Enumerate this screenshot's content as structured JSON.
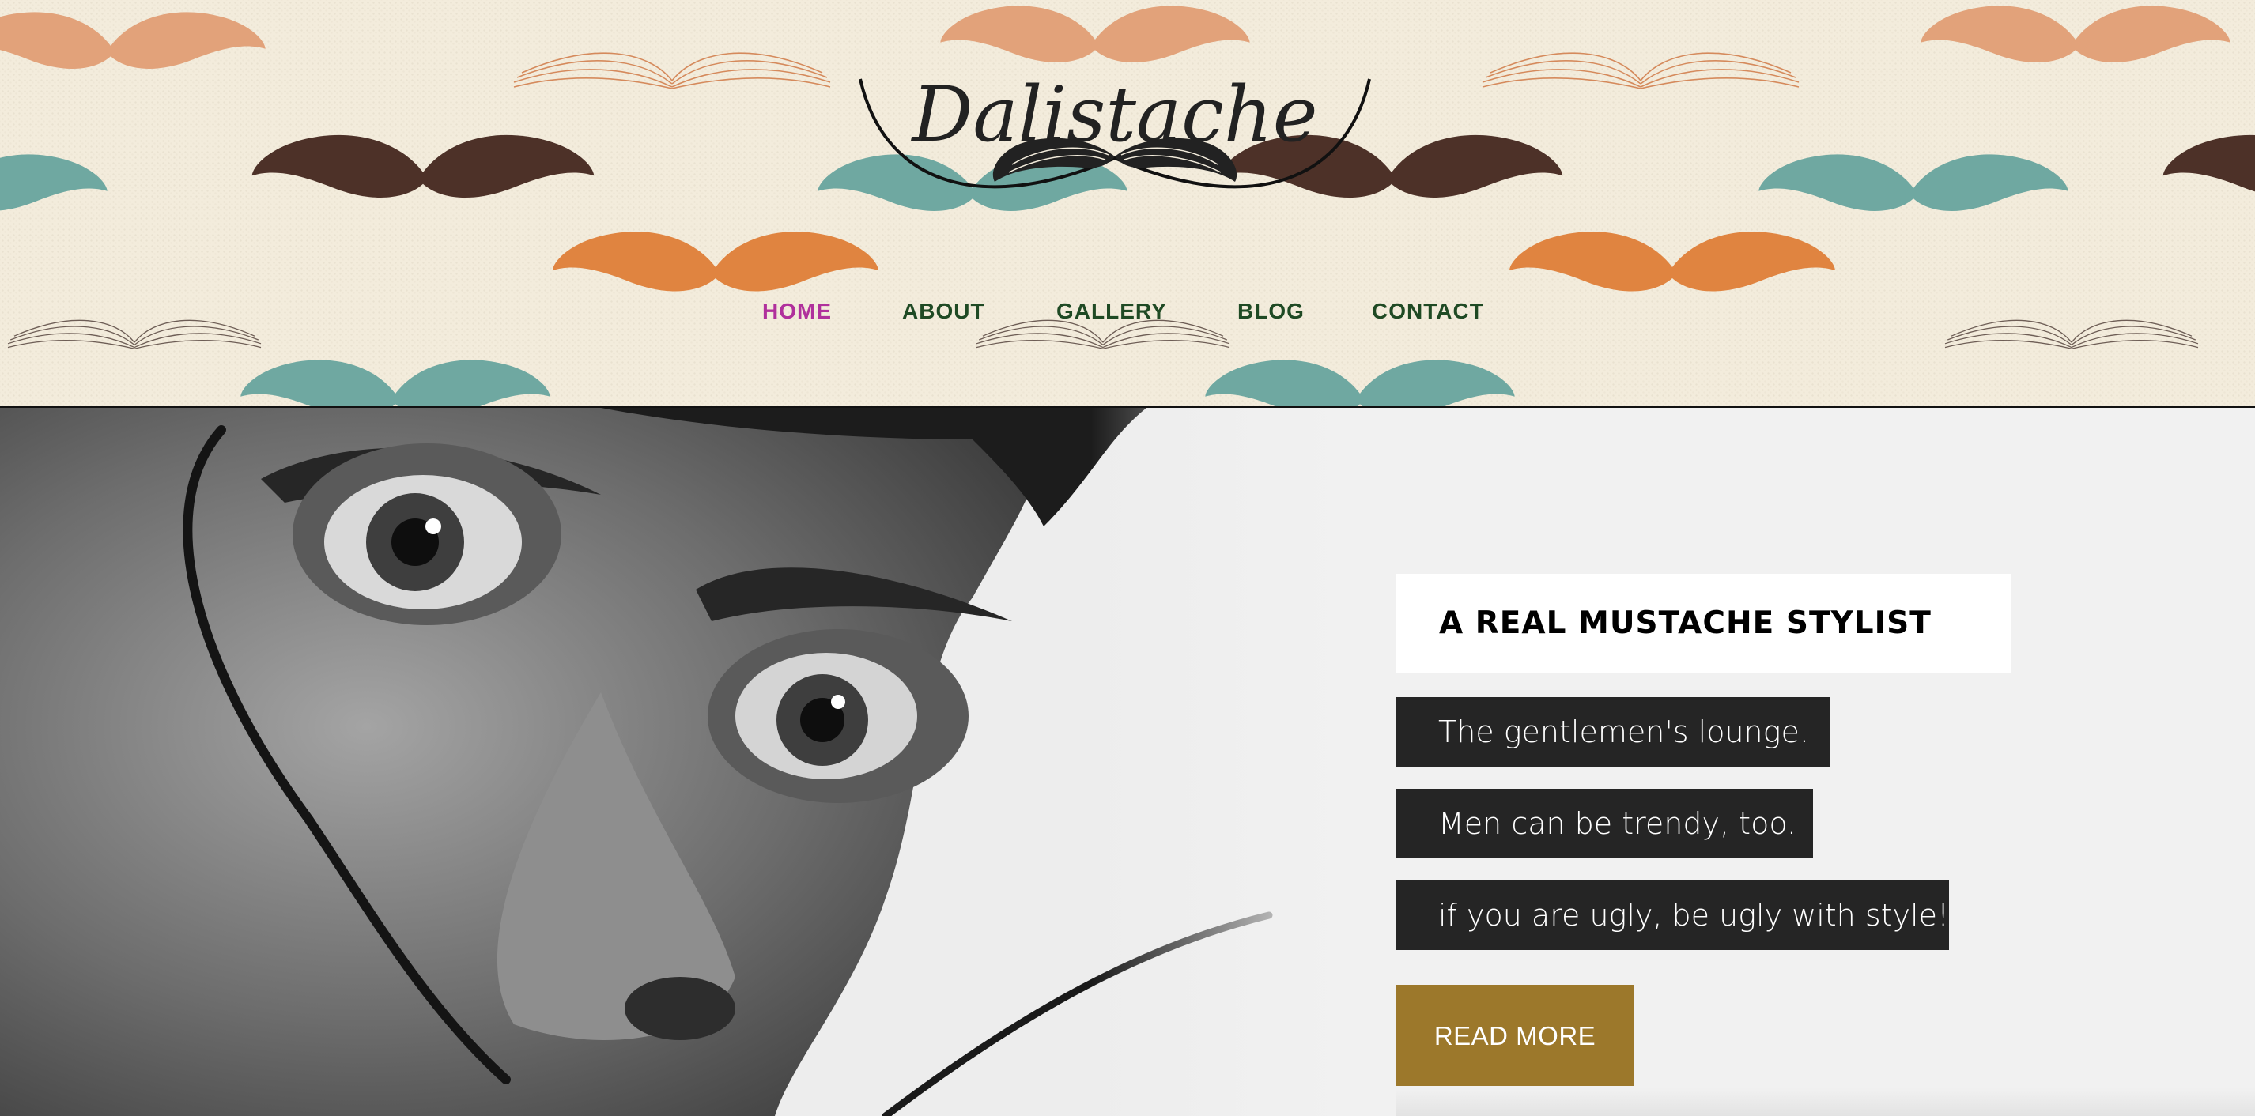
{
  "header": {
    "logo_text": "Dalistache",
    "nav": [
      {
        "label": "HOME",
        "active": true
      },
      {
        "label": "ABOUT",
        "active": false
      },
      {
        "label": "GALLERY",
        "active": false
      },
      {
        "label": "BLOG",
        "active": false
      },
      {
        "label": "CONTACT",
        "active": false
      }
    ]
  },
  "hero": {
    "headline": "A REAL MUSTACHE STYLIST",
    "taglines": [
      "The gentlemen's lounge.",
      "Men can be trendy, too.",
      "if you are ugly, be ugly with style!"
    ],
    "cta_label": "READ MORE"
  },
  "colors": {
    "header_bg": "#f3ecdc",
    "nav_text": "#1f4a24",
    "nav_active": "#b0309c",
    "tag_bg": "#252525",
    "cta_bg": "#9c782b",
    "mustache_peach": "#e2a27a",
    "mustache_brown": "#4d3128",
    "mustache_teal": "#6fa8a1",
    "mustache_orange": "#e08440"
  }
}
